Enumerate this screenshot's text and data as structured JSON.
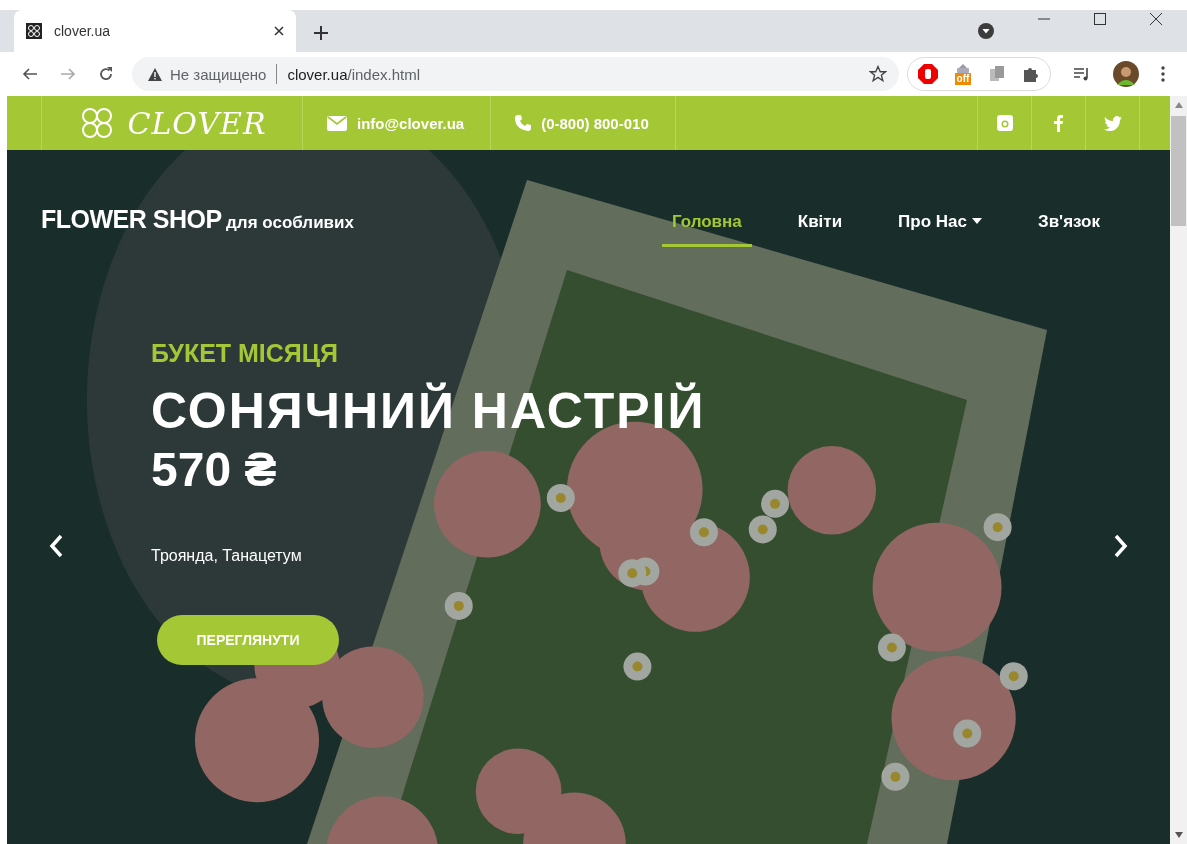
{
  "browser": {
    "tab_title": "clover.ua",
    "security": "Не защищено",
    "url_host": "clover.ua",
    "url_path": "/index.html",
    "extension_badge": "off"
  },
  "topbar": {
    "logo": "CLOVER",
    "email": "info@clover.ua",
    "phone": "(0-800) 800-010"
  },
  "brand": {
    "main": "FLOWER SHOP",
    "sub": "для особливих"
  },
  "nav": [
    {
      "label": "Головна",
      "selected": true,
      "dropdown": false
    },
    {
      "label": "Квіти",
      "selected": false,
      "dropdown": false
    },
    {
      "label": "Про Нас",
      "selected": false,
      "dropdown": true
    },
    {
      "label": "Зв'язок",
      "selected": false,
      "dropdown": false
    }
  ],
  "slide": {
    "kicker": "БУКЕТ МІСЯЦЯ",
    "title": "СОНЯЧНИЙ НАСТРІЙ",
    "price": "570 ₴",
    "description": "Троянда, Танацетум",
    "button": "ПЕРЕГЛЯНУТИ"
  }
}
